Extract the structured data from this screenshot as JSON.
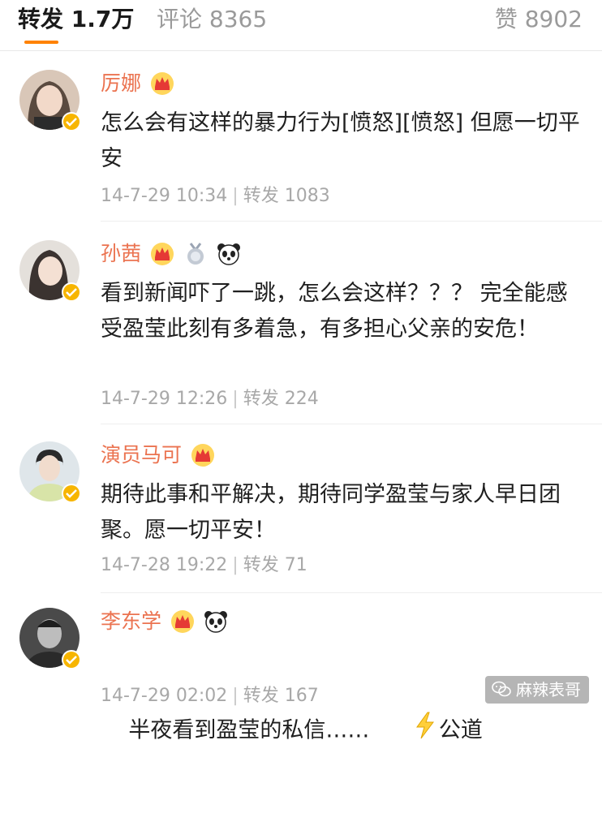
{
  "tabs": {
    "repost_label": "转发",
    "repost_count": "1.7万",
    "comment_label": "评论",
    "comment_count": "8365",
    "like_label": "赞",
    "like_count": "8902"
  },
  "posts": [
    {
      "name": "厉娜",
      "badges": [
        "crown-badge-icon"
      ],
      "content": "怎么会有这样的暴力行为[愤怒][愤怒] 但愿一切平安",
      "time": "14-7-29 10:34",
      "repost_label": "转发",
      "repost_count": "1083"
    },
    {
      "name": "孙茜",
      "badges": [
        "crown-badge-icon",
        "medal-badge-icon",
        "panda-badge-icon"
      ],
      "content": "看到新闻吓了一跳，怎么会这样？？？ 完全能感受盈莹此刻有多着急，有多担心父亲的安危！",
      "time": "14-7-29 12:26",
      "repost_label": "转发",
      "repost_count": "224"
    },
    {
      "name": "演员马可",
      "badges": [
        "crown-badge-icon"
      ],
      "content": "期待此事和平解决，期待同学盈莹与家人早日团聚。愿一切平安！",
      "time": "14-7-28 19:22",
      "repost_label": "转发",
      "repost_count": "71"
    },
    {
      "name": "李东学",
      "badges": [
        "crown-badge-icon",
        "panda-badge-icon"
      ],
      "content": "半夜看到盈莹的私信……",
      "content_icon": "lightning-icon",
      "content_tail": "公道",
      "time": "14-7-29 02:02",
      "repost_label": "转发",
      "repost_count": "167"
    }
  ],
  "watermark": {
    "text": "麻辣表哥",
    "icon": "wechat-icon"
  },
  "colors": {
    "accent": "#ff8200",
    "username": "#eb7350",
    "verified": "#f7b500",
    "meta": "#a8a8a8"
  }
}
